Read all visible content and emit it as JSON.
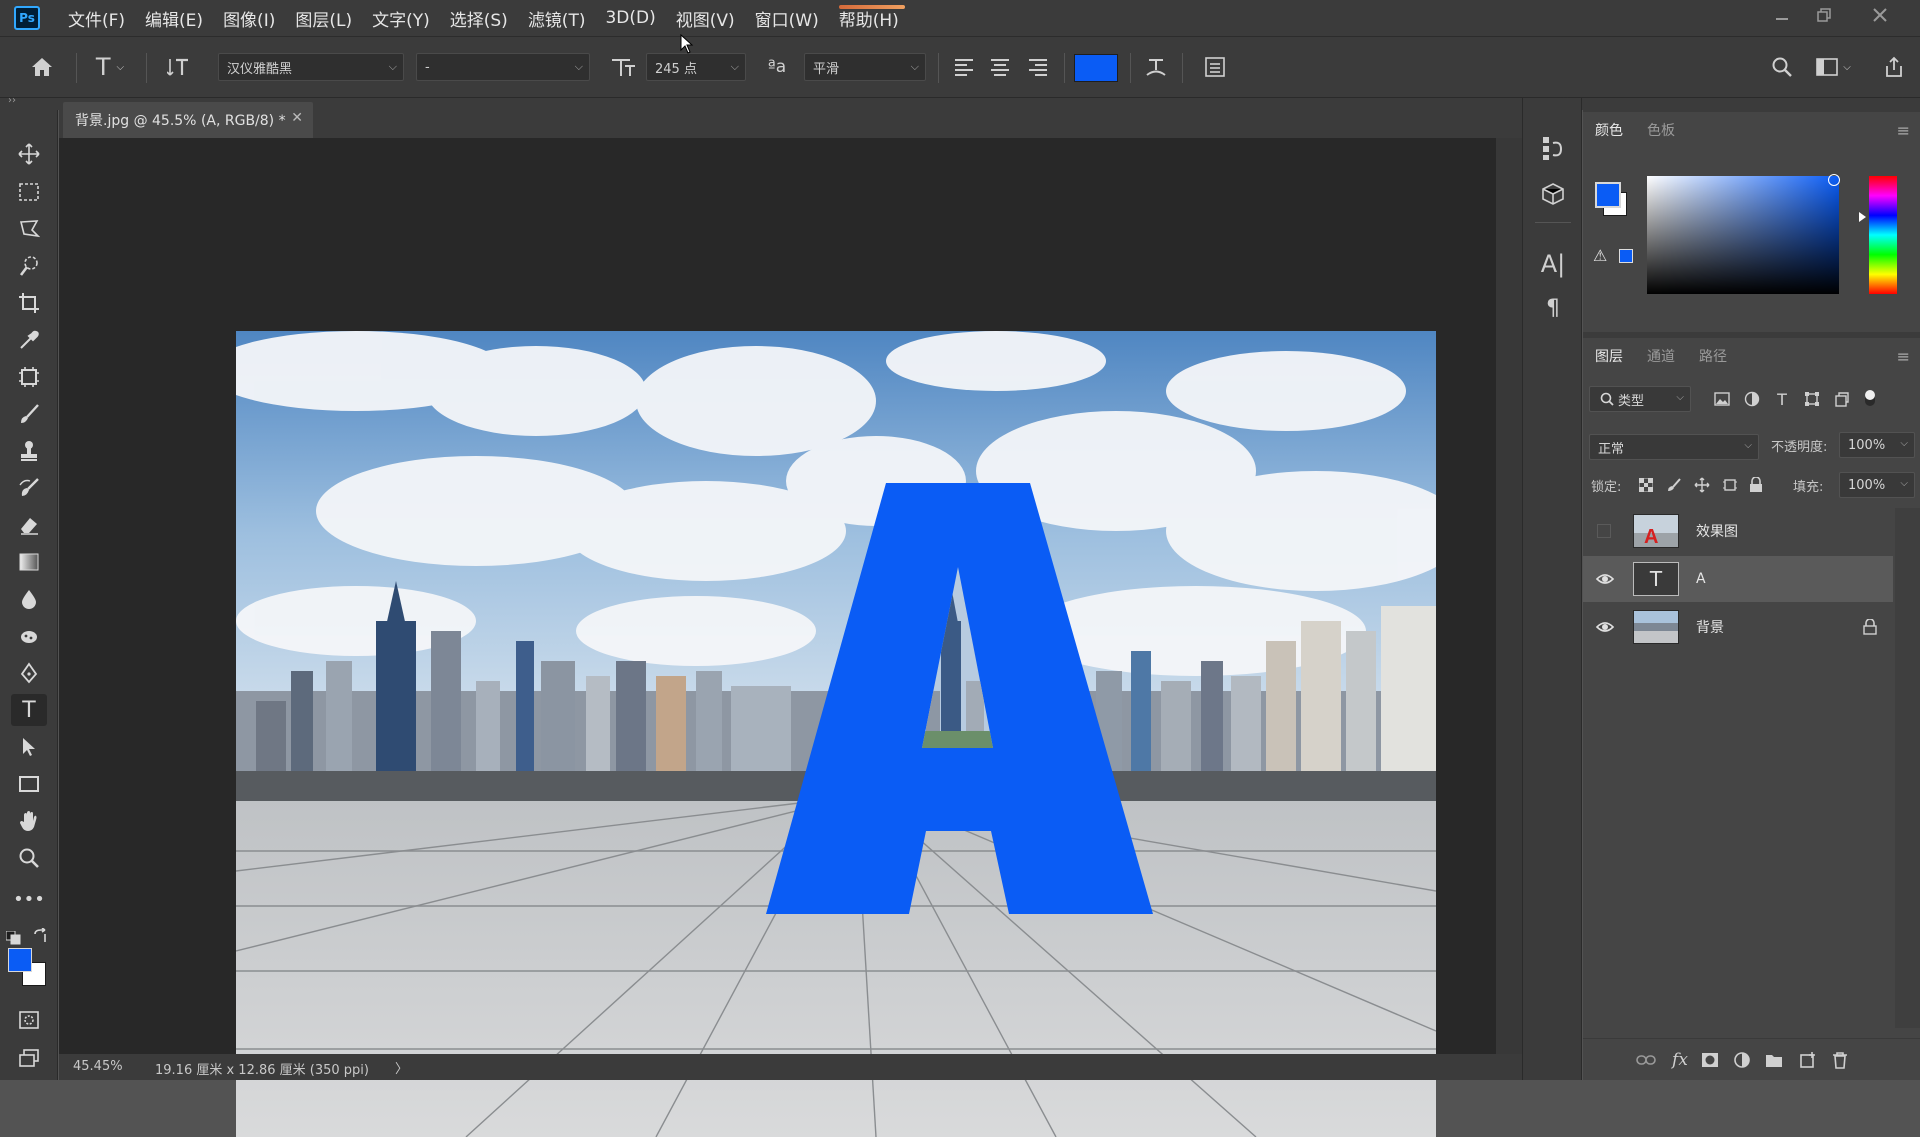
{
  "app": {
    "logo": "Ps"
  },
  "menu": [
    "文件(F)",
    "编辑(E)",
    "图像(I)",
    "图层(L)",
    "文字(Y)",
    "选择(S)",
    "滤镜(T)",
    "3D(D)",
    "视图(V)",
    "窗口(W)",
    "帮助(H)"
  ],
  "options": {
    "font_family": "汉仪雅酷黑",
    "font_style": "-",
    "font_size": "245 点",
    "aa_glyph": "ªa",
    "antialias": "平滑",
    "text_color": "#0a5cf5"
  },
  "document": {
    "tab_title": "背景.jpg @ 45.5% (A, RGB/8) *",
    "close_glyph": "✕",
    "canvas_letter": "A",
    "letter_color": "#0a5cf5"
  },
  "status": {
    "zoom": "45.45%",
    "info": "19.16 厘米 x 12.86 厘米 (350 ppi)",
    "arrow": "〉"
  },
  "color_panel": {
    "tabs": [
      "颜色",
      "色板"
    ],
    "foreground": "#0a5cf5",
    "background": "#ffffff"
  },
  "layers_panel": {
    "tabs": [
      "图层",
      "通道",
      "路径"
    ],
    "filter_label": "类型",
    "blend_mode": "正常",
    "opacity_label": "不透明度:",
    "opacity_value": "100%",
    "lock_label": "锁定:",
    "fill_label": "填充:",
    "fill_value": "100%",
    "layers": [
      {
        "name": "效果图",
        "visible": false,
        "selected": false,
        "kind": "image"
      },
      {
        "name": "A",
        "visible": true,
        "selected": true,
        "kind": "text"
      },
      {
        "name": "背景",
        "visible": true,
        "selected": false,
        "kind": "photo",
        "locked": true
      }
    ]
  }
}
